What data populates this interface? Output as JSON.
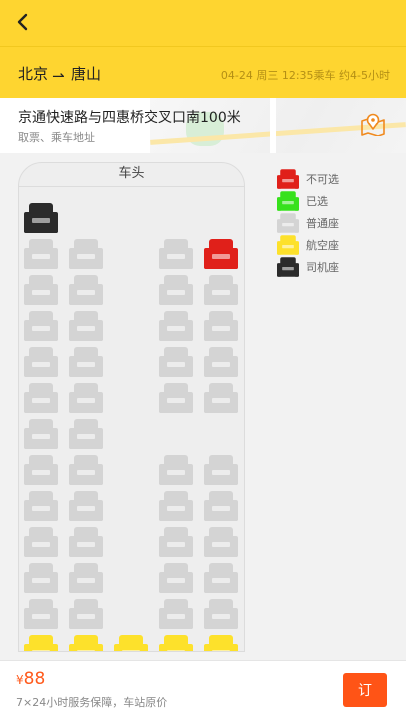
{
  "header": {
    "back_label": "back"
  },
  "route": {
    "from": "北京",
    "arrow": "⇀",
    "to": "唐山",
    "meta": "04-24 周三 12:35乘车 约4-5小时"
  },
  "address": {
    "main": "京通快速路与四惠桥交叉口南100米",
    "sub": "取票、乘车地址"
  },
  "cabin": {
    "head_label": "车头"
  },
  "colors": {
    "unavailable": "#e0201a",
    "selected": "#37e11c",
    "normal": "#d4d4d4",
    "aviation": "#fde12b",
    "driver": "#2b2b2b",
    "accent": "#fed530",
    "price": "#ff5a1c"
  },
  "legend": [
    {
      "label": "不可选",
      "status": "unavailable"
    },
    {
      "label": "已选",
      "status": "selected"
    },
    {
      "label": "普通座",
      "status": "normal"
    },
    {
      "label": "航空座",
      "status": "aviation"
    },
    {
      "label": "司机座",
      "status": "driver"
    }
  ],
  "seat_map": {
    "driver_seat": {
      "status": "driver"
    },
    "rows": [
      [
        "normal",
        "normal",
        null,
        "normal",
        "unavailable"
      ],
      [
        "normal",
        "normal",
        null,
        "normal",
        "normal"
      ],
      [
        "normal",
        "normal",
        null,
        "normal",
        "normal"
      ],
      [
        "normal",
        "normal",
        null,
        "normal",
        "normal"
      ],
      [
        "normal",
        "normal",
        null,
        "normal",
        "normal"
      ],
      [
        "normal",
        "normal",
        null,
        null,
        null
      ],
      [
        "normal",
        "normal",
        null,
        "normal",
        "normal"
      ],
      [
        "normal",
        "normal",
        null,
        "normal",
        "normal"
      ],
      [
        "normal",
        "normal",
        null,
        "normal",
        "normal"
      ],
      [
        "normal",
        "normal",
        null,
        "normal",
        "normal"
      ],
      [
        "normal",
        "normal",
        null,
        "normal",
        "normal"
      ],
      [
        "aviation",
        "aviation",
        "aviation",
        "aviation",
        "aviation"
      ]
    ]
  },
  "footer": {
    "currency": "¥",
    "price": "88",
    "promise": "7×24小时服务保障，车站原价",
    "order_label": "订"
  }
}
